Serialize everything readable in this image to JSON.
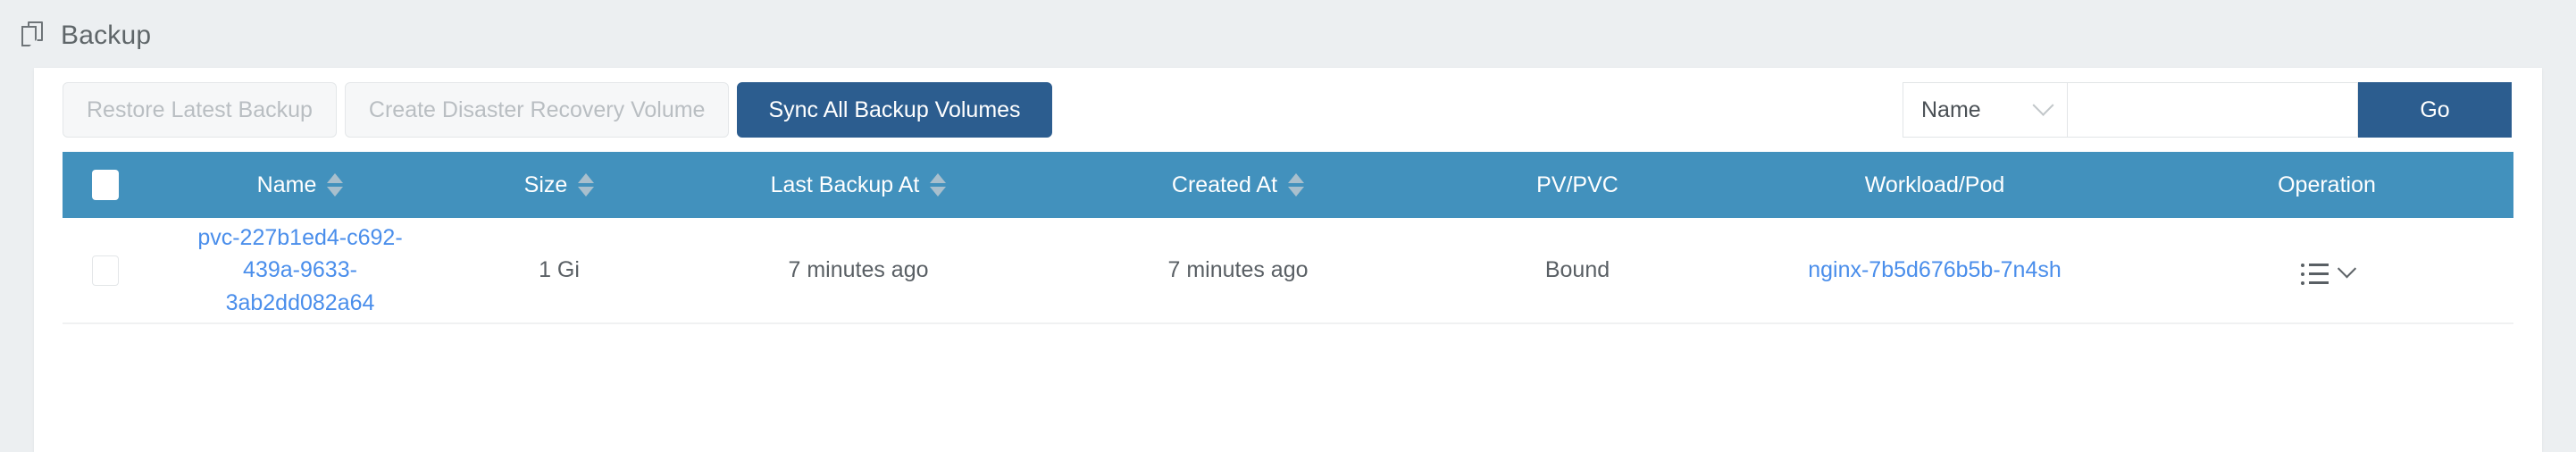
{
  "header": {
    "title": "Backup",
    "icon": "copy-document-icon"
  },
  "toolbar": {
    "restore_label": "Restore Latest Backup",
    "create_dr_label": "Create Disaster Recovery Volume",
    "sync_label": "Sync All Backup Volumes",
    "primary_color": "#2c5d8f",
    "disabled_text_color": "#b9bec2"
  },
  "search": {
    "filter_selected": "Name",
    "filter_chevron": "chevron-down-icon",
    "input_value": "",
    "input_placeholder": "",
    "go_label": "Go"
  },
  "table": {
    "header_bg": "#4291bd",
    "columns": [
      {
        "label": "",
        "sortable": false,
        "type": "checkbox"
      },
      {
        "label": "Name",
        "sortable": true
      },
      {
        "label": "Size",
        "sortable": true
      },
      {
        "label": "Last Backup At",
        "sortable": true
      },
      {
        "label": "Created At",
        "sortable": true
      },
      {
        "label": "PV/PVC",
        "sortable": false
      },
      {
        "label": "Workload/Pod",
        "sortable": false
      },
      {
        "label": "Operation",
        "sortable": false
      }
    ],
    "rows": [
      {
        "selected": false,
        "name": "pvc-227b1ed4-c692-439a-9633-3ab2dd082a64",
        "size": "1 Gi",
        "last_backup_at": "7 minutes ago",
        "created_at": "7 minutes ago",
        "pv_pvc": "Bound",
        "workload_pod": "nginx-7b5d676b5b-7n4sh",
        "operation_icon": "list-menu-icon",
        "operation_chevron": "chevron-down-icon"
      }
    ],
    "link_color": "#4a8eeb"
  }
}
